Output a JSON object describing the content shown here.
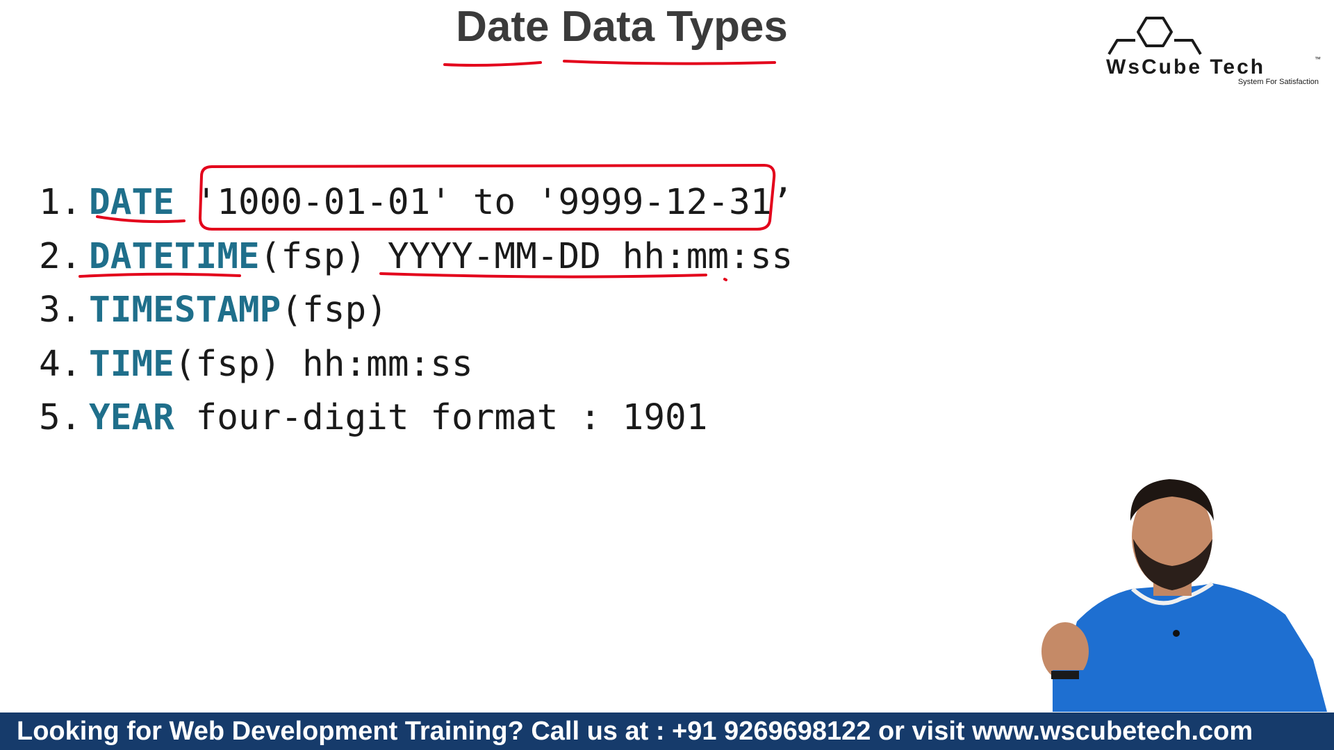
{
  "slide": {
    "title": "Date Data Types",
    "logo": {
      "brand": "WsCube Tech",
      "trademark": "™",
      "tagline": "System For Satisfaction"
    },
    "items": [
      {
        "number": "1.",
        "keyword": "DATE",
        "detail": " '1000-01-01' to '9999-12-31’"
      },
      {
        "number": "2.",
        "keyword": "DATETIME",
        "detail": "(fsp) YYYY-MM-DD hh:mm:ss"
      },
      {
        "number": "3.",
        "keyword": "TIMESTAMP",
        "detail": "(fsp)"
      },
      {
        "number": "4.",
        "keyword": "TIME",
        "detail": "(fsp) hh:mm:ss"
      },
      {
        "number": "5.",
        "keyword": "YEAR",
        "detail": " four-digit format : 1901"
      }
    ]
  },
  "banner": {
    "text": "Looking for Web Development Training? Call us at : +91 9269698122 or visit www.wscubetech.com"
  },
  "colors": {
    "keyword": "#1f6f8b",
    "annotation": "#e3001b",
    "banner_background": "#163b6b",
    "title": "#3b3b3b"
  }
}
